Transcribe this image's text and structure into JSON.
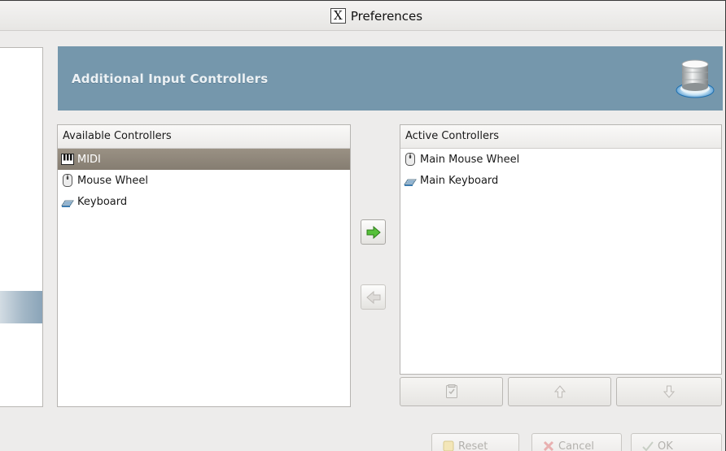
{
  "window": {
    "title": "Preferences",
    "x_logo_glyph": "X"
  },
  "banner": {
    "title": "Additional Input Controllers",
    "icon": "input-controllers-icon",
    "color": "#7597ac"
  },
  "available": {
    "header": "Available Controllers",
    "items": [
      {
        "label": "MIDI",
        "icon": "midi-keyboard-icon",
        "selected": true
      },
      {
        "label": "Mouse Wheel",
        "icon": "mouse-icon",
        "selected": false
      },
      {
        "label": "Keyboard",
        "icon": "keyboard-icon",
        "selected": false
      }
    ]
  },
  "active": {
    "header": "Active Controllers",
    "items": [
      {
        "label": "Main Mouse Wheel",
        "icon": "mouse-icon"
      },
      {
        "label": "Main Keyboard",
        "icon": "keyboard-icon"
      }
    ]
  },
  "transfer": {
    "add_icon": "arrow-right-icon",
    "remove_icon": "arrow-left-icon",
    "add_color": "#4caf2a"
  },
  "order_buttons": {
    "configure_icon": "configure-icon",
    "up_icon": "arrow-up-icon",
    "down_icon": "arrow-down-icon"
  },
  "dialog_buttons": {
    "reset": "Reset",
    "cancel": "Cancel",
    "ok": "OK"
  }
}
